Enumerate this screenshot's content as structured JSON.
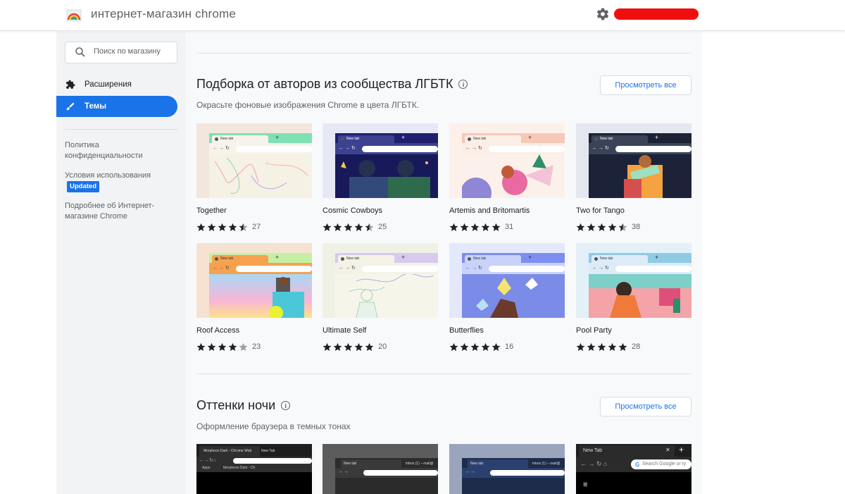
{
  "header": {
    "title": "интернет-магазин chrome",
    "logo_icon": "chrome-webstore-rainbow-icon",
    "settings_icon": "gear-icon",
    "account_color": "#f10e0e"
  },
  "sidebar": {
    "search_placeholder": "Поиск по магазину",
    "nav": [
      {
        "label": "Расширения",
        "icon": "puzzle-icon",
        "active": false
      },
      {
        "label": "Темы",
        "icon": "brush-icon",
        "active": true
      }
    ],
    "links": {
      "privacy": "Политика конфиденциальности",
      "terms": "Условия использования",
      "terms_badge": "Updated",
      "about": "Подробнее об Интернет-магазине Chrome"
    }
  },
  "sections": [
    {
      "title": "Подборка от авторов из сообщества ЛГБТК",
      "subtitle": "Окрасьте фоновые изображения Chrome в цвета ЛГБТК.",
      "view_all": "Просмотреть все",
      "items": [
        {
          "name": "Together",
          "rating": 4.5,
          "count": "27",
          "tab_text": "New tab"
        },
        {
          "name": "Cosmic Cowboys",
          "rating": 4.5,
          "count": "25",
          "tab_text": "New tab"
        },
        {
          "name": "Artemis and Britomartis",
          "rating": 5,
          "count": "31",
          "tab_text": "New tab"
        },
        {
          "name": "Two for Tango",
          "rating": 4.5,
          "count": "38",
          "tab_text": "New tab"
        },
        {
          "name": "Roof Access",
          "rating": 4,
          "count": "23",
          "tab_text": "New tab"
        },
        {
          "name": "Ultimate Self",
          "rating": 5,
          "count": "20",
          "tab_text": "New tab"
        },
        {
          "name": "Butterflies",
          "rating": 5,
          "count": "16",
          "tab_text": "New tab"
        },
        {
          "name": "Pool Party",
          "rating": 5,
          "count": "28",
          "tab_text": "New tab"
        }
      ]
    },
    {
      "title": "Оттенки ночи",
      "subtitle": "Оформление браузера в темных тонах",
      "view_all": "Просмотреть все",
      "previews": [
        {
          "tab1": "Morpheon Dark - Chrome Web",
          "tab2": "New Tab",
          "bookmark1": "Apps",
          "bookmark2": "Morpheon Dark - Ch"
        },
        {
          "tab1": "New tab",
          "tab2": "Inbox (1) – mail@"
        },
        {
          "tab1": "New tab",
          "tab2": "Inbox (1) – mail@"
        },
        {
          "tab1": "New Tab",
          "omnibox": "Search Google or ty"
        }
      ]
    }
  ]
}
